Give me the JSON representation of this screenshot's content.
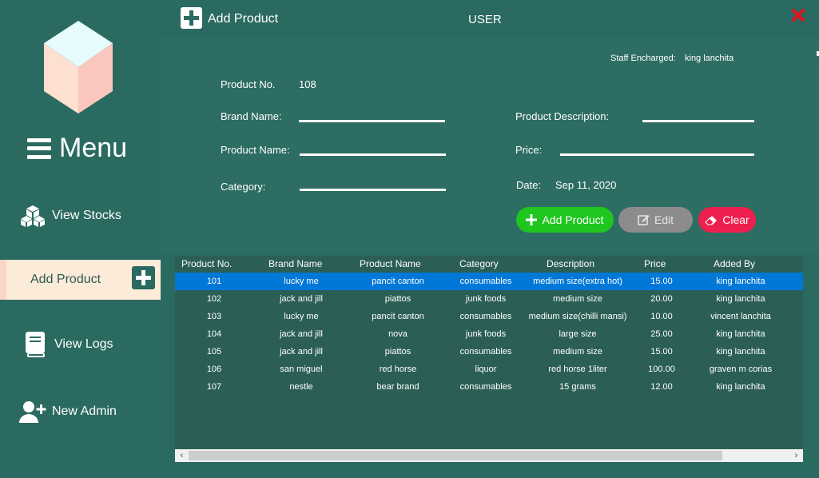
{
  "window": {
    "title": "Add Product",
    "user_label": "USER",
    "close_icon": "close-x-icon"
  },
  "sidebar": {
    "menu_label": "Menu",
    "items": [
      {
        "label": "View Stocks",
        "icon": "cubes-icon"
      },
      {
        "label": "Add Product",
        "icon": "plus-box-icon"
      },
      {
        "label": "View Logs",
        "icon": "book-icon"
      },
      {
        "label": "New Admin",
        "icon": "user-plus-icon"
      }
    ]
  },
  "form": {
    "staff_label": "Staff Encharged:",
    "staff_value": "king lanchita",
    "product_no_label": "Product No.",
    "product_no_value": "108",
    "brand_name_label": "Brand Name:",
    "product_name_label": "Product Name:",
    "category_label": "Category:",
    "description_label": "Product Description:",
    "price_label": "Price:",
    "date_label": "Date:",
    "date_value": "Sep 11, 2020",
    "add_button": "Add Product",
    "edit_button": "Edit",
    "clear_button": "Clear"
  },
  "table": {
    "columns": [
      "Product No.",
      "Brand Name",
      "Product Name",
      "Category",
      "Description",
      "Price",
      "Added By"
    ],
    "rows": [
      [
        "101",
        "lucky me",
        "pancit canton",
        "consumables",
        "medium size(extra hot)",
        "15.00",
        "king lanchita"
      ],
      [
        "102",
        "jack and jill",
        "piattos",
        "junk foods",
        "medium size",
        "20.00",
        "king lanchita"
      ],
      [
        "103",
        "lucky me",
        "pancit canton",
        "consumables",
        "medium size(chilli mansi)",
        "10.00",
        "vincent lanchita"
      ],
      [
        "104",
        "jack and jill",
        "nova",
        "junk foods",
        "large size",
        "25.00",
        "king lanchita"
      ],
      [
        "105",
        "jack and jill",
        "piattos",
        "consumables",
        "medium size",
        "15.00",
        "king lanchita"
      ],
      [
        "106",
        "san miguel",
        "red horse",
        "liquor",
        "red horse 1liter",
        "100.00",
        "graven m corias"
      ],
      [
        "107",
        "nestle",
        "bear brand",
        "consumables",
        "15 grams",
        "12.00",
        "king lanchita"
      ]
    ],
    "selected_row": 0,
    "scroll_left": "‹",
    "scroll_right": "›"
  },
  "colors": {
    "background": "#2b6a60",
    "selection": "#0078d7",
    "add_green": "#1ec61e",
    "edit_gray": "#8c8c8c",
    "clear_red": "#ee1f4f",
    "active_item": "#fcebd9"
  }
}
